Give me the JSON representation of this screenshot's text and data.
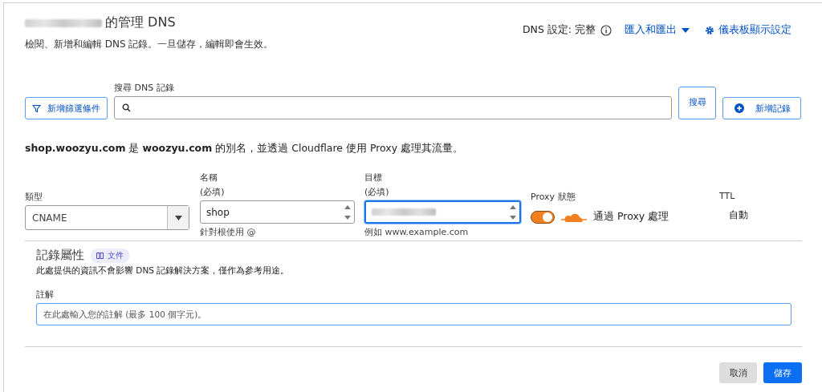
{
  "header": {
    "title": "的管理 DNS",
    "subtitle": "檢閱、新增和編輯 DNS 記錄。一旦儲存，編輯即會生效。",
    "dns_setup": "DNS 設定: 完整",
    "import_export": "匯入和匯出",
    "dashboard_settings": "儀表板顯示設定"
  },
  "toolbar": {
    "filter_button": "新增篩選條件",
    "search_label": "搜尋 DNS 記錄",
    "search_button": "搜尋",
    "add_button": "新增記錄"
  },
  "alias_note": "**shop.woozyu.com** 是 **woozyu.com** 的別名，並透過 Cloudflare 使用 Proxy 處理其流量。",
  "form": {
    "type": {
      "label": "類型",
      "value": "CNAME"
    },
    "name": {
      "label": "名稱",
      "required": "(必填)",
      "value": "shop",
      "hint": "針對根使用 @",
      "focused": false
    },
    "target": {
      "label": "目標",
      "required": "(必填)",
      "hint": "例如 www.example.com",
      "focused": true
    },
    "proxy": {
      "label": "Proxy 狀態",
      "on": true,
      "text": "通過 Proxy 處理"
    },
    "ttl": {
      "label": "TTL",
      "value": "自動"
    }
  },
  "attributes": {
    "title": "記錄屬性",
    "doc_badge": "文件",
    "description": "此處提供的資訊不會影響 DNS 記錄解決方案，僅作為參考用途。",
    "comment_label": "註解",
    "comment_placeholder": "在此處輸入您的註解 (最多 100 個字元)。"
  },
  "buttons": {
    "cancel": "取消",
    "save": "儲存"
  }
}
